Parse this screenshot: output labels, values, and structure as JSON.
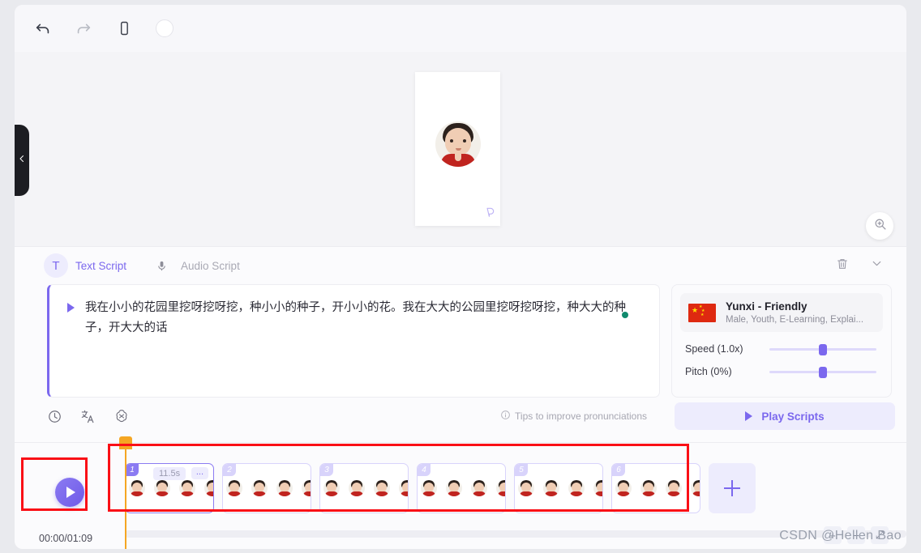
{
  "toolbar": {
    "undo": "undo-icon",
    "redo": "redo-icon",
    "device": "phone-icon",
    "toggle": "circle-toggle"
  },
  "stage": {
    "drawer_handle": "chevron-left-icon",
    "zoom_in": "zoom-in-icon",
    "preview_watermark": "brand-logo"
  },
  "script_panel": {
    "tabs": [
      {
        "label": "Text Script",
        "badge": "T",
        "active": true
      },
      {
        "label": "Audio Script",
        "badge": "mic-icon",
        "active": false
      }
    ],
    "header_actions": [
      {
        "name": "delete-script",
        "icon": "trash-icon"
      },
      {
        "name": "collapse-panel",
        "icon": "chevron-down-icon"
      }
    ],
    "script_text": "我在小小的花园里挖呀挖呀挖，种小小的种子，开小小的花。我在大大的公园里挖呀挖呀挖，种大大的种子，开大大的话",
    "footer_icons": [
      {
        "name": "history-icon"
      },
      {
        "name": "translate-icon"
      },
      {
        "name": "ai-assistant-icon"
      }
    ],
    "tips": "Tips to improve pronunciations",
    "play_scripts": "Play Scripts"
  },
  "voice": {
    "name": "Yunxi - Friendly",
    "tags": "Male, Youth, E-Learning, Explai...",
    "flag": "china-flag",
    "speed_label": "Speed (1.0x)",
    "speed_value": 50,
    "pitch_label": "Pitch (0%)",
    "pitch_value": 50
  },
  "timeline": {
    "timecode": "00:00/01:09",
    "add_clip": "+",
    "clips": [
      {
        "num": "1",
        "duration": "11.5s",
        "more": "...",
        "selected": true,
        "thumbs": 4
      },
      {
        "num": "2",
        "selected": false,
        "thumbs": 4
      },
      {
        "num": "3",
        "selected": false,
        "thumbs": 4
      },
      {
        "num": "4",
        "selected": false,
        "thumbs": 4
      },
      {
        "num": "5",
        "selected": false,
        "thumbs": 4
      },
      {
        "num": "6",
        "selected": false,
        "thumbs": 4
      }
    ],
    "zoom_controls": [
      "+",
      "−",
      "⤢"
    ]
  },
  "colors": {
    "accent": "#7b68ee",
    "accent_soft": "#edecfd",
    "annotation": "#fa0f16",
    "playhead": "#f5a623",
    "status_dot": "#0f8a6d"
  },
  "watermark": "CSDN @Hellen Bao"
}
